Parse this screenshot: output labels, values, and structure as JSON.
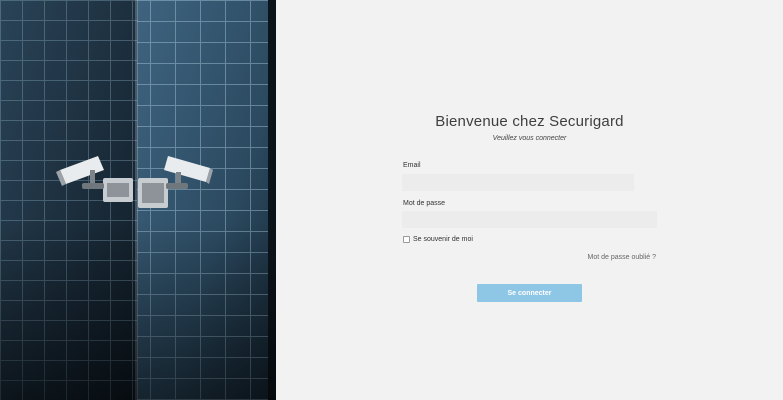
{
  "hero": {
    "description_icon": "security-camera-icon"
  },
  "login": {
    "title": "Bienvenue chez Securigard",
    "subtitle": "Veuillez vous connecter",
    "email_label": "Email",
    "email_value": "",
    "email_placeholder": "",
    "password_label": "Mot de passe",
    "password_value": "",
    "password_placeholder": "",
    "remember_label": "Se souvenir de moi",
    "remember_checked": false,
    "forgot_label": "Mot de passe oublié ?",
    "submit_label": "Se connecter"
  },
  "colors": {
    "background": "#f2f2f2",
    "input_background": "#ececec",
    "button": "#8ec6e6",
    "button_text": "#ffffff",
    "title": "#3f3f3f"
  }
}
